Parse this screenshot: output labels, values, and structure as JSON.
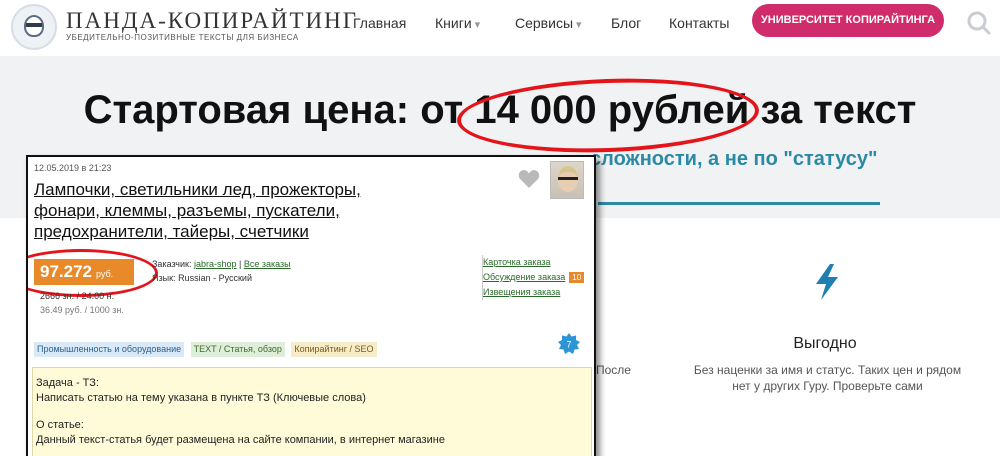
{
  "header": {
    "logo_title": "ПАНДА-КОПИРАЙТИНГ",
    "logo_tagline": "УБЕДИТЕЛЬНО-ПОЗИТИВНЫЕ ТЕКСТЫ ДЛЯ БИЗНЕСА",
    "nav": [
      {
        "label": "Главная",
        "caret": ""
      },
      {
        "label": "Книги",
        "caret": "▾"
      },
      {
        "label": "Сервисы",
        "caret": "▾"
      },
      {
        "label": "Блог",
        "caret": ""
      },
      {
        "label": "Контакты",
        "caret": ""
      }
    ],
    "cta_label": "УНИВЕРСИТЕТ КОПИРАЙТИНГА",
    "search_icon": "search-icon"
  },
  "hero": {
    "title": "Стартовая цена: от 14 000 рублей за текст",
    "subtitle": "сложности, а не по \"статусу\""
  },
  "benefit": {
    "icon": "lightning-icon",
    "title": "Выгодно",
    "text": "Без наценки за имя и статус. Таких цен и рядом нет у других Гуру. Проверьте сами",
    "left_fragment": "После"
  },
  "order_card": {
    "date": "12.05.2019 в 21:23",
    "title": "Лампочки, светильники лед, прожекторы, фонари, клеммы, разъемы, пускатели, предохранители, тайеры, счетчики",
    "price": "97.272",
    "price_currency": "руб.",
    "chars": "2666 зн. / 24.00 н.",
    "rate": "36.49 руб. / 1000 зн.",
    "customer_label": "Заказчик:",
    "customer_name": "jabra-shop",
    "all_orders": "Все заказы",
    "language_label": "Язык:",
    "language_value": "Russian - Русский",
    "links": {
      "card": "Карточка заказа",
      "discussion": "Обсуждение заказа",
      "discussion_count": "10",
      "notices": "Извещения заказа"
    },
    "tags": [
      "Промышленность и оборудование",
      "TEXT / Статья, обзор",
      "Копирайтинг / SEO"
    ],
    "gear_count": "7",
    "description": {
      "task_heading": "Задача - ТЗ:",
      "task_text": "Написать статью на тему указана в пункте ТЗ (Ключевые слова)",
      "about_heading": "О статье:",
      "about_text": "Данный текст-статья будет размещена на сайте компании, в интернет магазине"
    }
  },
  "colors": {
    "accent_pink": "#d02c6b",
    "hero_teal": "#2a8aa6",
    "highlight_red": "#e4141b",
    "price_orange": "#e8892a"
  }
}
